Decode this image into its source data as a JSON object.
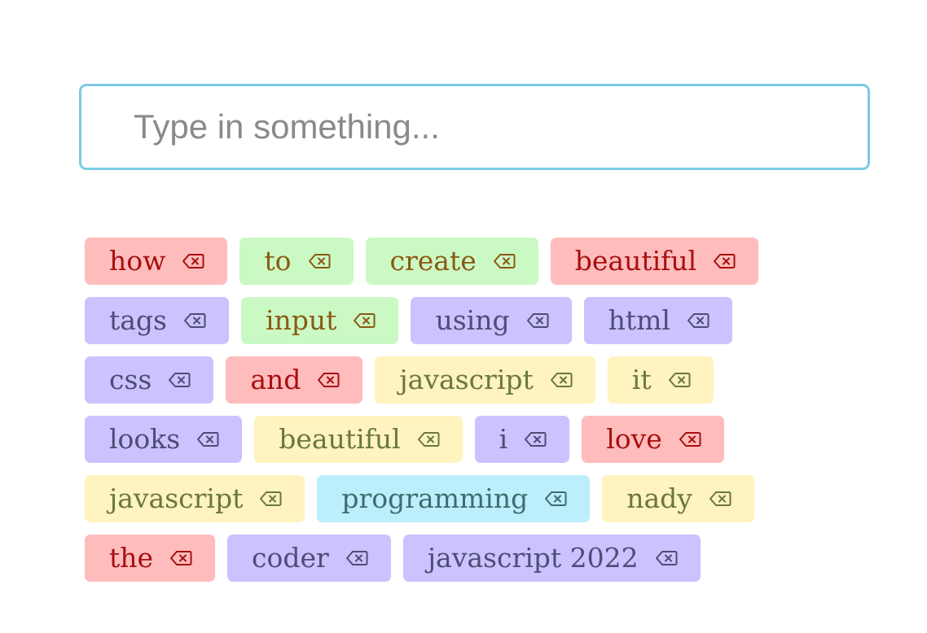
{
  "input": {
    "placeholder": "Type in something...",
    "value": ""
  },
  "icons": {
    "delete": "backspace-icon"
  },
  "colors": {
    "input_border": "#7ec9e3",
    "red_bg": "#ffbcbc",
    "green_bg": "#cbf9c4",
    "purple_bg": "#ccc2ff",
    "yellow_bg": "#fff3bf",
    "blue_bg": "#bdeefb"
  },
  "tags": [
    {
      "label": "how",
      "color": "red"
    },
    {
      "label": "to",
      "color": "green"
    },
    {
      "label": "create",
      "color": "green"
    },
    {
      "label": "beautiful",
      "color": "red"
    },
    {
      "label": "tags",
      "color": "purple"
    },
    {
      "label": "input",
      "color": "green"
    },
    {
      "label": "using",
      "color": "purple"
    },
    {
      "label": "html",
      "color": "purple"
    },
    {
      "label": "css",
      "color": "purple"
    },
    {
      "label": "and",
      "color": "red"
    },
    {
      "label": "javascript",
      "color": "yellow"
    },
    {
      "label": "it",
      "color": "yellow"
    },
    {
      "label": "looks",
      "color": "purple"
    },
    {
      "label": "beautiful",
      "color": "yellow"
    },
    {
      "label": "i",
      "color": "purple"
    },
    {
      "label": "love",
      "color": "red"
    },
    {
      "label": "javascript",
      "color": "yellow"
    },
    {
      "label": "programming",
      "color": "blue"
    },
    {
      "label": "nady",
      "color": "yellow"
    },
    {
      "label": "the",
      "color": "red"
    },
    {
      "label": "coder",
      "color": "purple"
    },
    {
      "label": "javascript 2022",
      "color": "purple"
    }
  ]
}
